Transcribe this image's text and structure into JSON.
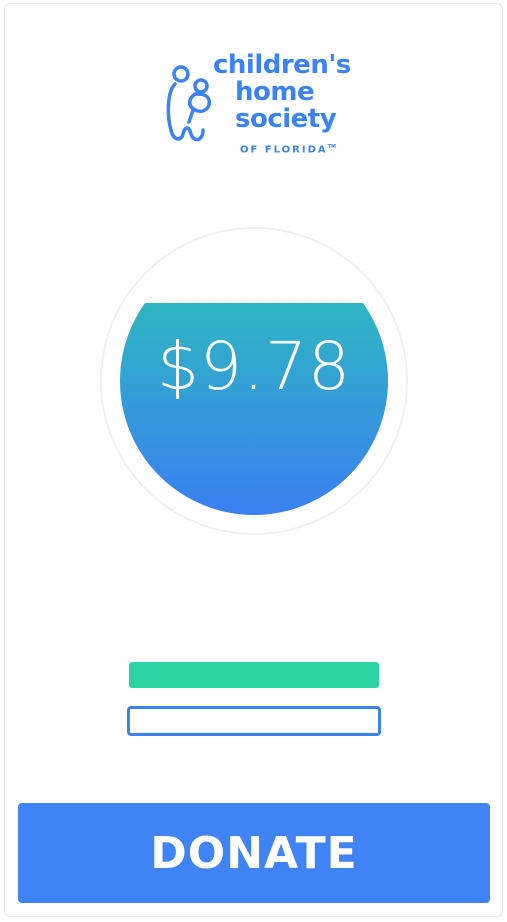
{
  "logo": {
    "line1": "children's",
    "line2": "home",
    "line3": "society",
    "sub": "OF FLORIDA",
    "tm": "TM",
    "color": "#3b82f6"
  },
  "gauge": {
    "amount": "$9.78",
    "fill_fraction": 0.79,
    "gradient_top": "#2fb5c3",
    "gradient_bottom": "#3a7ff0"
  },
  "options": {
    "green_bar_color": "#2dd4a4",
    "outline_bar_color": "#3b82f6"
  },
  "donate": {
    "label": "DONATE",
    "color": "#3f83f4"
  }
}
